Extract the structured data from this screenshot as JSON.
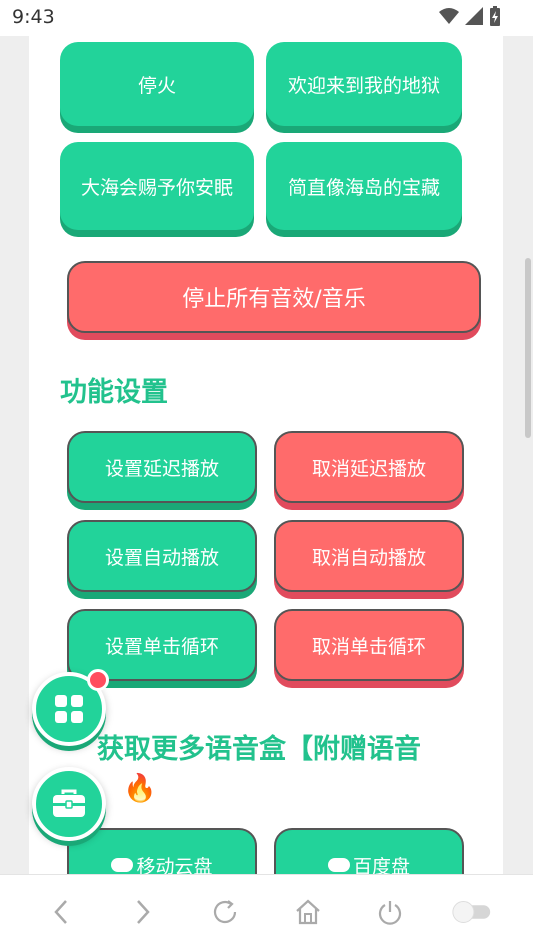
{
  "status": {
    "time": "9:43"
  },
  "top_buttons": [
    {
      "label": "停火"
    },
    {
      "label": "欢迎来到我的地狱"
    },
    {
      "label": "大海会赐予你安眠"
    },
    {
      "label": "简直像海岛的宝藏"
    }
  ],
  "stop_all_label": "停止所有音效/音乐",
  "settings": {
    "title": "功能设置",
    "rows": [
      {
        "set": "设置延迟播放",
        "cancel": "取消延迟播放"
      },
      {
        "set": "设置自动播放",
        "cancel": "取消自动播放"
      },
      {
        "set": "设置单击循环",
        "cancel": "取消单击循环"
      }
    ]
  },
  "more": {
    "title_line1": "获取更多语音盒【附赠语音",
    "title_line2": "🔥"
  },
  "cloud": [
    {
      "label": "移动云盘"
    },
    {
      "label": "百度盘"
    }
  ],
  "colors": {
    "green": "#22d39a",
    "red": "#ff6b6b",
    "title_green": "#22c28d"
  }
}
